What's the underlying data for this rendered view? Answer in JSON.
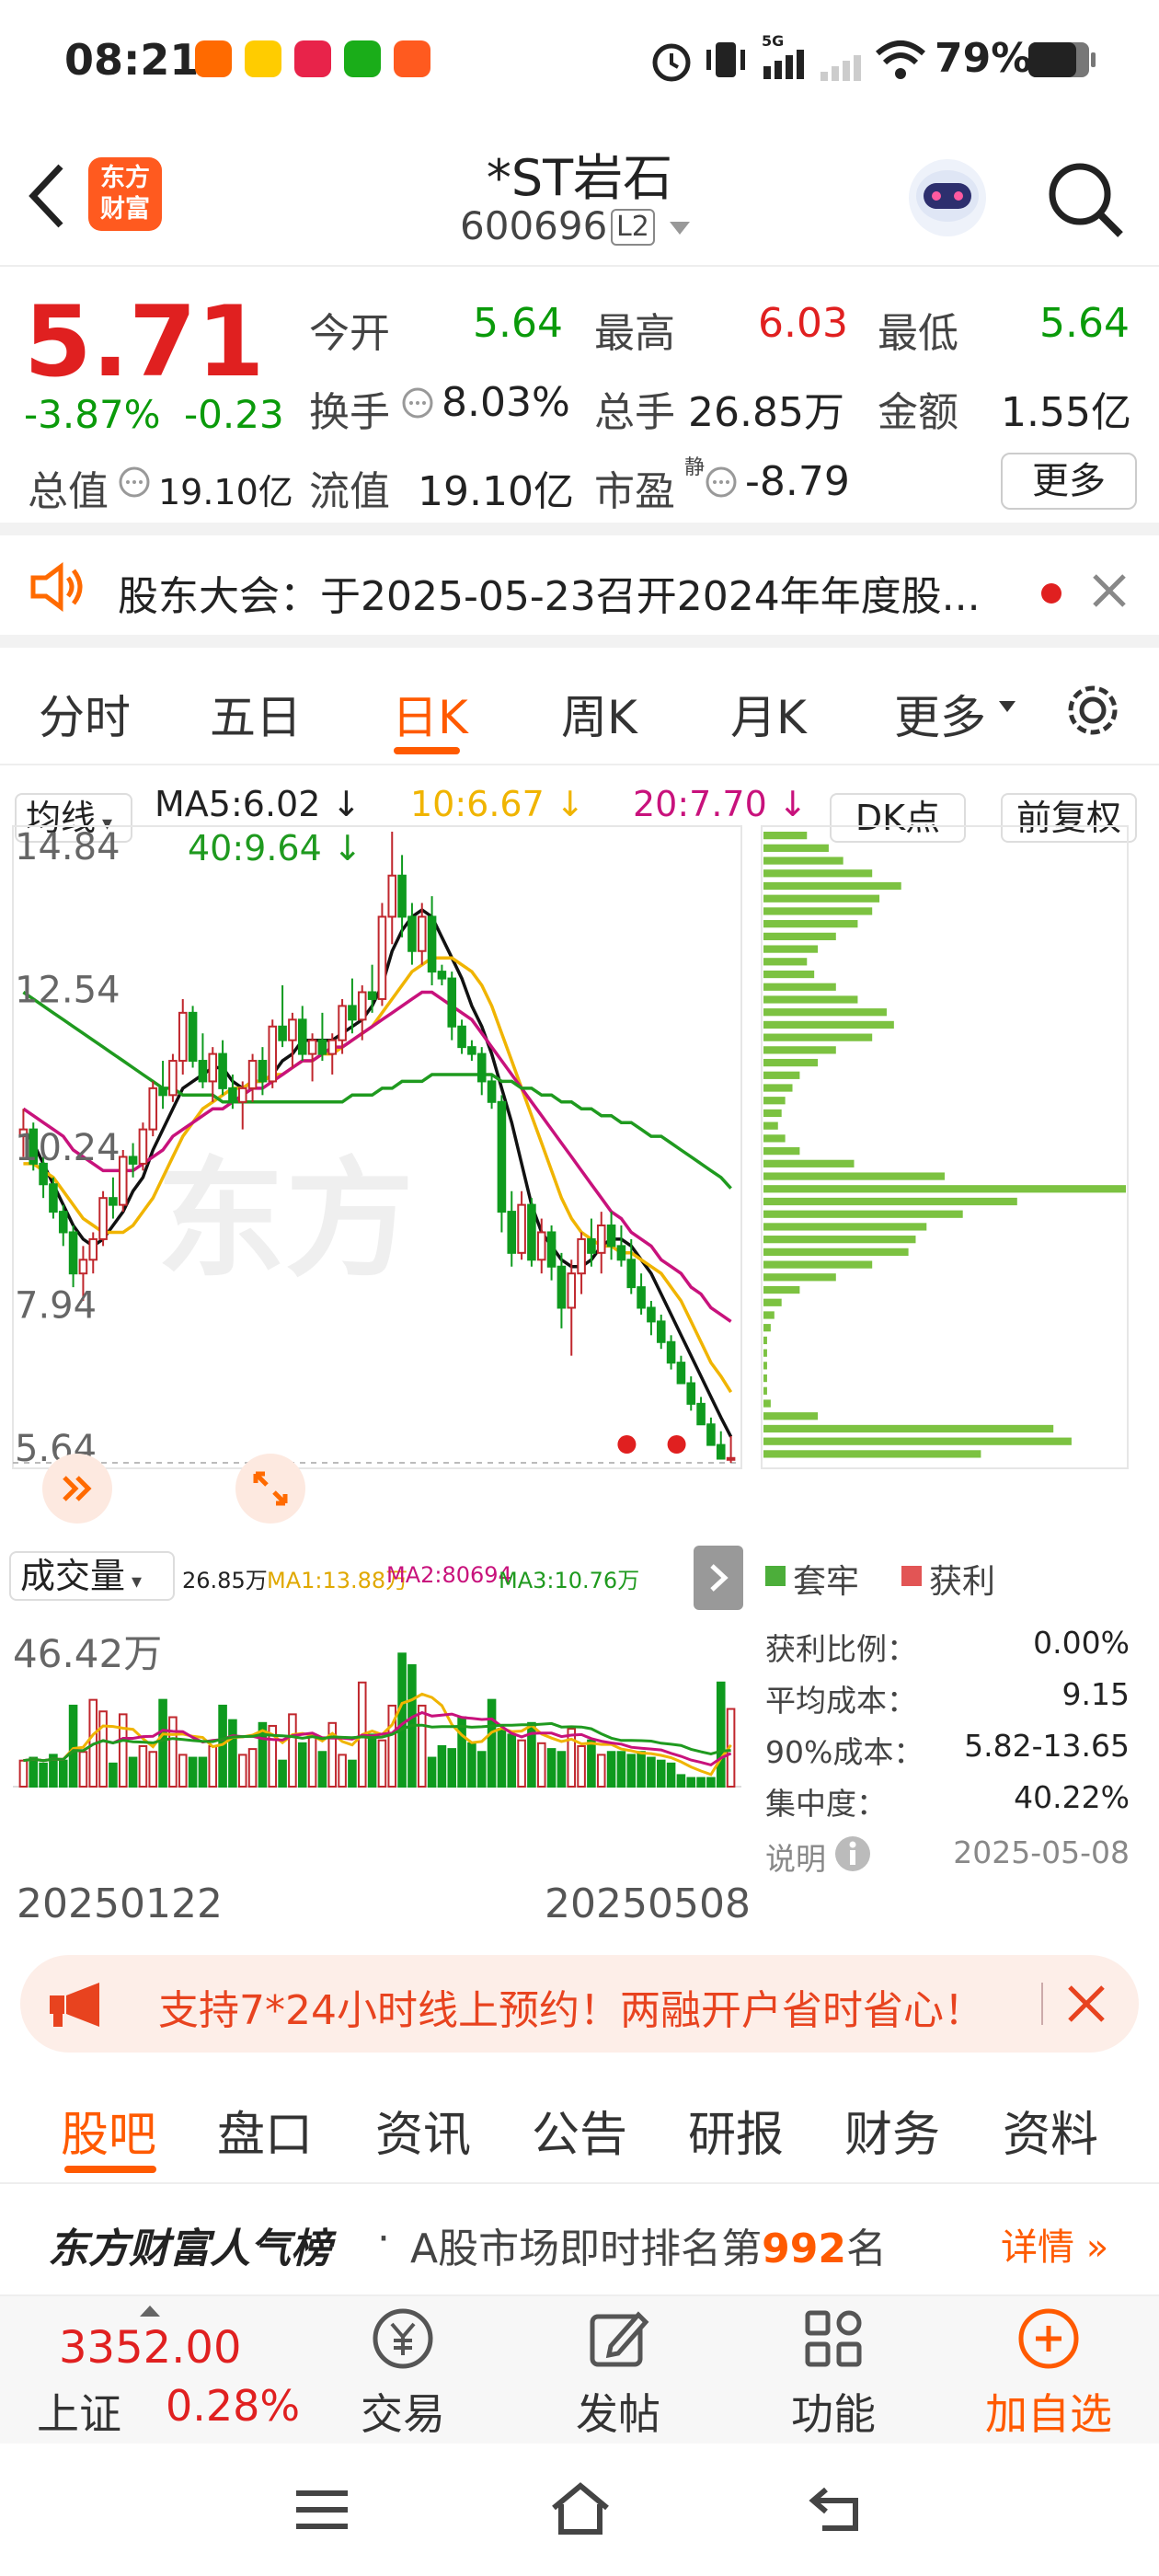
{
  "status_bar": {
    "time": "08:21",
    "battery": "79%",
    "network": "5G"
  },
  "header": {
    "logo_text_1": "东方",
    "logo_text_2": "财富",
    "title": "*ST岩石",
    "code": "600696",
    "level_badge": "L2"
  },
  "quote": {
    "price": "5.71",
    "change_pct": "-3.87%",
    "change": "-0.23",
    "open_label": "今开",
    "open": "5.64",
    "high_label": "最高",
    "high": "6.03",
    "low_label": "最低",
    "low": "5.64",
    "turnover_label": "换手",
    "turnover": "8.03%",
    "volume_label": "总手",
    "volume": "26.85万",
    "amount_label": "金额",
    "amount": "1.55亿",
    "total_mv_label": "总值",
    "total_mv": "19.10亿",
    "float_mv_label": "流值",
    "float_mv": "19.10亿",
    "pe_label": "市盈",
    "pe_sup": "静",
    "pe": "-8.79",
    "more_button": "更多"
  },
  "notice": {
    "text": "股东大会：于2025-05-23召开2024年年度股..."
  },
  "k_tabs": [
    "分时",
    "五日",
    "日K",
    "周K",
    "月K",
    "更多"
  ],
  "k_tab_active": "日K",
  "indicators": {
    "ma_select": "均线",
    "ma5": "MA5:6.02",
    "ma10": "10:6.67",
    "ma20": "20:7.70",
    "ma40": "40:9.64",
    "dk_button": "DK点",
    "adjust_button": "前复权"
  },
  "chart_data": {
    "type": "candlestick",
    "y_ticks": [
      "14.84",
      "12.54",
      "10.24",
      "7.94",
      "5.64"
    ],
    "ylim": [
      5.64,
      14.84
    ],
    "x_start": "20250122",
    "x_end": "20250508",
    "candles": [
      [
        10.4,
        10.8,
        10.1,
        10.5
      ],
      [
        10.5,
        10.6,
        9.9,
        10.0
      ],
      [
        10.0,
        10.1,
        9.5,
        9.7
      ],
      [
        9.7,
        9.8,
        9.2,
        9.3
      ],
      [
        9.3,
        9.4,
        8.8,
        9.0
      ],
      [
        9.0,
        9.1,
        8.2,
        8.4
      ],
      [
        8.4,
        8.8,
        8.0,
        8.6
      ],
      [
        8.6,
        9.0,
        8.4,
        8.9
      ],
      [
        8.9,
        9.6,
        8.8,
        9.5
      ],
      [
        9.5,
        9.8,
        9.2,
        9.4
      ],
      [
        9.4,
        10.2,
        9.3,
        10.1
      ],
      [
        10.1,
        10.3,
        9.8,
        10.0
      ],
      [
        10.0,
        10.6,
        9.9,
        10.5
      ],
      [
        10.5,
        11.2,
        10.4,
        11.1
      ],
      [
        11.1,
        11.5,
        10.8,
        11.0
      ],
      [
        11.0,
        11.6,
        10.9,
        11.5
      ],
      [
        11.5,
        12.4,
        11.3,
        12.2
      ],
      [
        12.2,
        12.3,
        11.4,
        11.5
      ],
      [
        11.5,
        11.9,
        11.1,
        11.2
      ],
      [
        11.2,
        11.7,
        10.9,
        11.6
      ],
      [
        11.6,
        11.8,
        11.0,
        11.1
      ],
      [
        11.1,
        11.3,
        10.8,
        10.9
      ],
      [
        10.9,
        11.2,
        10.5,
        11.1
      ],
      [
        11.1,
        11.6,
        10.9,
        11.5
      ],
      [
        11.5,
        11.7,
        11.0,
        11.2
      ],
      [
        11.2,
        12.1,
        11.1,
        12.0
      ],
      [
        12.0,
        12.6,
        11.7,
        11.8
      ],
      [
        11.8,
        12.2,
        11.4,
        12.1
      ],
      [
        12.1,
        12.3,
        11.5,
        11.6
      ],
      [
        11.6,
        11.9,
        11.2,
        11.8
      ],
      [
        11.8,
        12.2,
        11.5,
        11.6
      ],
      [
        11.6,
        11.9,
        11.3,
        11.8
      ],
      [
        11.8,
        12.4,
        11.6,
        12.3
      ],
      [
        12.3,
        12.7,
        11.9,
        12.1
      ],
      [
        12.1,
        12.6,
        11.8,
        12.5
      ],
      [
        12.5,
        12.9,
        12.2,
        12.4
      ],
      [
        12.4,
        13.8,
        12.3,
        13.6
      ],
      [
        13.6,
        14.84,
        13.2,
        14.2
      ],
      [
        14.2,
        14.5,
        13.3,
        13.6
      ],
      [
        13.6,
        13.8,
        12.9,
        13.1
      ],
      [
        13.1,
        13.8,
        12.9,
        13.6
      ],
      [
        13.6,
        13.9,
        12.6,
        12.8
      ],
      [
        12.8,
        12.9,
        12.6,
        12.7
      ],
      [
        12.7,
        12.8,
        11.8,
        12.0
      ],
      [
        12.0,
        12.1,
        11.6,
        11.7
      ],
      [
        11.7,
        11.8,
        11.5,
        11.6
      ],
      [
        11.6,
        11.7,
        11.0,
        11.2
      ],
      [
        11.2,
        11.3,
        10.8,
        10.9
      ],
      [
        10.9,
        11.0,
        9.0,
        9.3
      ],
      [
        9.3,
        9.6,
        8.5,
        8.7
      ],
      [
        8.7,
        9.6,
        8.6,
        9.4
      ],
      [
        9.4,
        9.5,
        8.5,
        8.6
      ],
      [
        8.6,
        9.2,
        8.4,
        9.0
      ],
      [
        9.0,
        9.1,
        8.3,
        8.5
      ],
      [
        8.5,
        8.7,
        7.6,
        7.9
      ],
      [
        7.9,
        8.6,
        7.2,
        8.4
      ],
      [
        8.4,
        9.0,
        8.1,
        8.9
      ],
      [
        8.9,
        9.2,
        8.5,
        8.7
      ],
      [
        8.7,
        9.3,
        8.4,
        9.1
      ],
      [
        9.1,
        9.3,
        8.6,
        8.8
      ],
      [
        8.8,
        9.1,
        8.5,
        8.6
      ],
      [
        8.6,
        8.9,
        8.1,
        8.2
      ],
      [
        8.2,
        8.4,
        7.8,
        7.9
      ],
      [
        7.9,
        8.0,
        7.5,
        7.7
      ],
      [
        7.7,
        7.8,
        7.3,
        7.4
      ],
      [
        7.4,
        7.5,
        7.0,
        7.1
      ],
      [
        7.1,
        7.2,
        6.8,
        6.8
      ],
      [
        6.8,
        6.9,
        6.4,
        6.5
      ],
      [
        6.5,
        6.6,
        6.2,
        6.2
      ],
      [
        6.2,
        6.3,
        5.9,
        5.9
      ],
      [
        5.9,
        6.1,
        5.7,
        5.7
      ],
      [
        5.7,
        6.03,
        5.64,
        5.71
      ]
    ],
    "ma_lines": {
      "ma5": [
        10.5,
        10.3,
        10.0,
        9.7,
        9.4,
        9.1,
        8.9,
        8.8,
        8.9,
        9.1,
        9.3,
        9.6,
        9.8,
        10.2,
        10.5,
        10.8,
        11.1,
        11.2,
        11.3,
        11.4,
        11.4,
        11.2,
        11.1,
        11.2,
        11.2,
        11.3,
        11.5,
        11.6,
        11.8,
        11.8,
        11.8,
        11.8,
        11.9,
        12.0,
        12.1,
        12.3,
        12.6,
        13.1,
        13.4,
        13.6,
        13.7,
        13.6,
        13.3,
        13.0,
        12.7,
        12.3,
        12.0,
        11.6,
        11.1,
        10.6,
        10.0,
        9.4,
        9.0,
        8.8,
        8.6,
        8.5,
        8.5,
        8.6,
        8.8,
        8.9,
        8.9,
        8.8,
        8.6,
        8.4,
        8.1,
        7.8,
        7.5,
        7.2,
        6.9,
        6.6,
        6.3,
        6.02
      ],
      "ma10": [
        10.0,
        10.0,
        9.9,
        9.8,
        9.6,
        9.4,
        9.2,
        9.1,
        9.0,
        9.0,
        9.0,
        9.1,
        9.3,
        9.5,
        9.8,
        10.1,
        10.4,
        10.6,
        10.8,
        10.9,
        11.0,
        11.1,
        11.1,
        11.2,
        11.2,
        11.3,
        11.3,
        11.4,
        11.5,
        11.5,
        11.6,
        11.6,
        11.7,
        11.8,
        11.9,
        12.0,
        12.2,
        12.4,
        12.6,
        12.8,
        12.9,
        13.0,
        13.0,
        13.0,
        12.9,
        12.8,
        12.6,
        12.3,
        11.9,
        11.5,
        11.1,
        10.7,
        10.3,
        9.9,
        9.5,
        9.2,
        9.0,
        8.9,
        8.8,
        8.8,
        8.7,
        8.7,
        8.6,
        8.5,
        8.4,
        8.2,
        8.0,
        7.7,
        7.4,
        7.1,
        6.9,
        6.67
      ],
      "ma20": [
        10.8,
        10.7,
        10.6,
        10.5,
        10.4,
        10.2,
        10.1,
        10.0,
        9.9,
        9.9,
        9.9,
        9.9,
        10.0,
        10.1,
        10.2,
        10.4,
        10.5,
        10.6,
        10.7,
        10.8,
        10.8,
        10.9,
        11.0,
        11.1,
        11.1,
        11.2,
        11.3,
        11.4,
        11.5,
        11.5,
        11.6,
        11.7,
        11.7,
        11.8,
        11.9,
        12.0,
        12.1,
        12.2,
        12.3,
        12.4,
        12.5,
        12.5,
        12.4,
        12.3,
        12.2,
        12.1,
        11.9,
        11.7,
        11.5,
        11.3,
        11.1,
        10.9,
        10.7,
        10.5,
        10.3,
        10.1,
        9.9,
        9.7,
        9.5,
        9.3,
        9.2,
        9.0,
        8.9,
        8.8,
        8.6,
        8.5,
        8.4,
        8.2,
        8.1,
        7.9,
        7.8,
        7.7
      ],
      "ma40": [
        12.5,
        12.4,
        12.3,
        12.2,
        12.1,
        12.0,
        11.9,
        11.8,
        11.7,
        11.6,
        11.5,
        11.4,
        11.3,
        11.2,
        11.1,
        11.1,
        11.0,
        11.0,
        11.0,
        11.0,
        10.9,
        10.9,
        10.9,
        10.9,
        10.9,
        10.9,
        10.9,
        10.9,
        10.9,
        10.9,
        10.9,
        10.9,
        10.9,
        11.0,
        11.0,
        11.0,
        11.1,
        11.1,
        11.2,
        11.2,
        11.2,
        11.3,
        11.3,
        11.3,
        11.3,
        11.3,
        11.3,
        11.3,
        11.2,
        11.2,
        11.1,
        11.1,
        11.0,
        11.0,
        10.9,
        10.9,
        10.8,
        10.8,
        10.7,
        10.7,
        10.6,
        10.6,
        10.5,
        10.4,
        10.4,
        10.3,
        10.2,
        10.1,
        10.0,
        9.9,
        9.8,
        9.64
      ]
    },
    "volume_label": "46.42万",
    "volume_max_wan": 46.42,
    "volumes_wan": [
      9,
      10,
      8,
      11,
      9,
      28,
      12,
      30,
      26,
      8,
      25,
      10,
      14,
      12,
      30,
      24,
      11,
      10,
      10,
      14,
      28,
      23,
      11,
      13,
      22,
      21,
      9,
      25,
      15,
      18,
      12,
      22,
      11,
      9,
      36,
      18,
      16,
      28,
      46,
      42,
      28,
      10,
      14,
      13,
      24,
      15,
      12,
      30,
      20,
      18,
      16,
      22,
      15,
      13,
      12,
      20,
      14,
      16,
      11,
      12,
      12,
      11,
      12,
      10,
      9,
      8,
      4,
      3,
      3,
      3,
      36,
      26.85
    ]
  },
  "volume_bar": {
    "select": "成交量",
    "vol": "26.85万",
    "ma1": "MA1:13.88万",
    "ma2": "MA2:80694",
    "ma3": "MA3:10.76万"
  },
  "chips": {
    "legend_trapped": "套牢",
    "legend_profit": "获利",
    "profit_ratio_label": "获利比例：",
    "profit_ratio": "0.00%",
    "avg_cost_label": "平均成本：",
    "avg_cost": "9.15",
    "cost90_label": "90%成本：",
    "cost90": "5.82-13.65",
    "concentration_label": "集中度：",
    "concentration": "40.22%",
    "note_label": "说明",
    "date": "2025-05-08",
    "distribution": [
      0.12,
      0.18,
      0.22,
      0.3,
      0.38,
      0.32,
      0.3,
      0.26,
      0.2,
      0.15,
      0.12,
      0.14,
      0.2,
      0.26,
      0.34,
      0.36,
      0.3,
      0.2,
      0.15,
      0.1,
      0.08,
      0.06,
      0.05,
      0.04,
      0.06,
      0.1,
      0.25,
      0.5,
      1.0,
      0.7,
      0.55,
      0.45,
      0.42,
      0.4,
      0.3,
      0.2,
      0.1,
      0.05,
      0.03,
      0.02,
      0.01,
      0.01,
      0.01,
      0.01,
      0.01,
      0.02,
      0.15,
      0.8,
      0.85,
      0.6
    ]
  },
  "promo": {
    "text": "支持7*24小时线上预约！两融开户省时省心！"
  },
  "bottom_tabs": [
    "股吧",
    "盘口",
    "资讯",
    "公告",
    "研报",
    "财务",
    "资料"
  ],
  "bottom_tab_active": "股吧",
  "rank": {
    "brand": "东方财富人气榜",
    "dot": "·",
    "text_before": "A股市场即时排名第",
    "rank_no": "992",
    "text_after": "名",
    "details": "详情"
  },
  "dock": {
    "index_value": "3352.00",
    "index_name": "上证",
    "index_change": "0.28%",
    "trade": "交易",
    "post": "发帖",
    "functions": "功能",
    "add_watch": "加自选"
  },
  "colors": {
    "red": "#e02020",
    "green": "#0a9a0a",
    "accent": "#ff6a00",
    "ma5": "#111111",
    "ma10": "#f0b400",
    "ma20": "#c8127c",
    "ma40": "#1f9a1f",
    "chip_bar": "#7cc241"
  }
}
